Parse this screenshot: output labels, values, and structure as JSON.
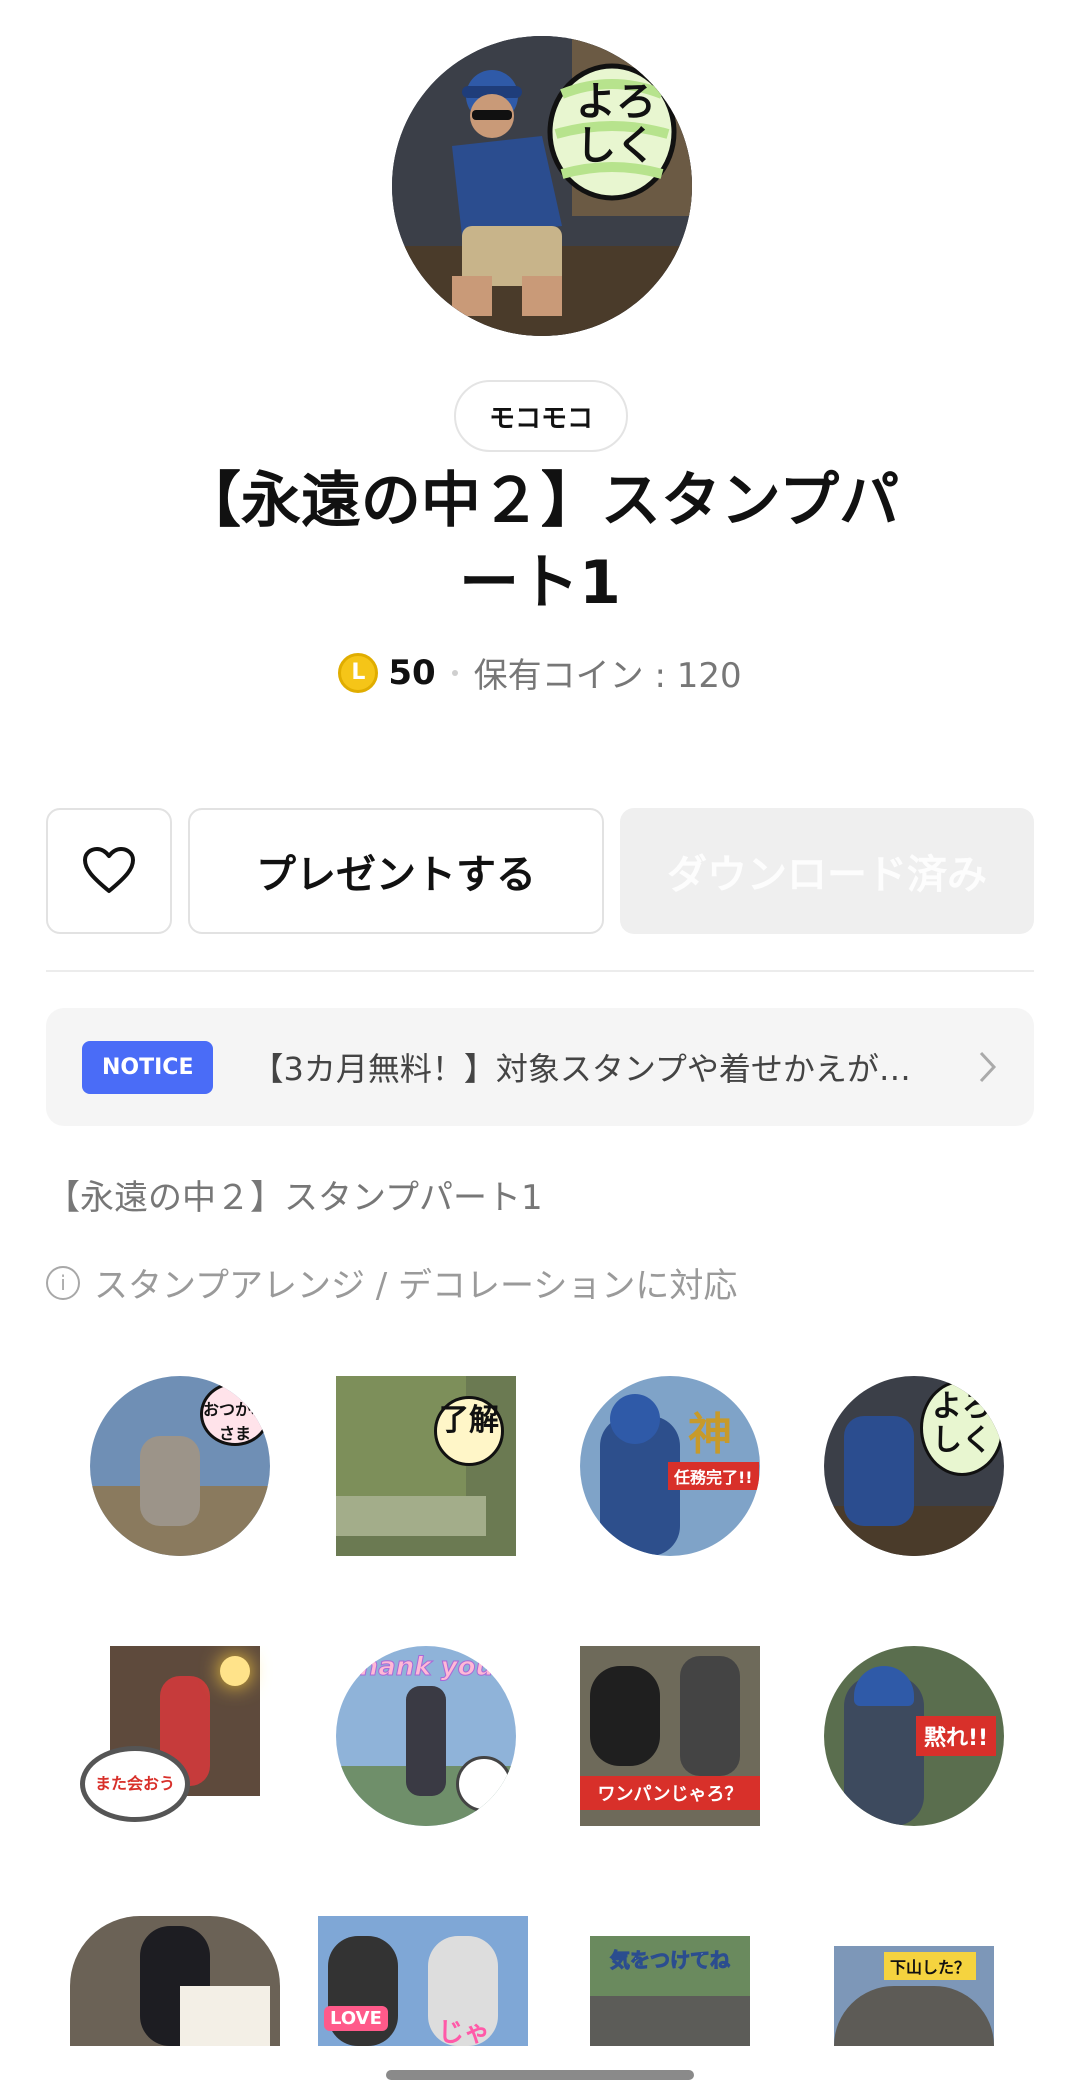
{
  "header": {
    "creator": "モコモコ",
    "title_line1": "【永遠の中２】スタンプパ",
    "title_line2": "ート1"
  },
  "pricing": {
    "coin_symbol": "L",
    "price": "50",
    "owned_coins": "保有コイン : 120"
  },
  "actions": {
    "present_label": "プレゼントする",
    "download_label": "ダウンロード済み"
  },
  "notice": {
    "badge": "NOTICE",
    "text": "【3カ月無料！】対象スタンプや着せかえが…"
  },
  "pack": {
    "name": "【永遠の中２】スタンプパート1",
    "support_text": "スタンプアレンジ / デコレーションに対応",
    "info_symbol": "i"
  },
  "hero_sticker": {
    "caption_line1": "よろ",
    "caption_line2": "しく"
  },
  "stickers": [
    {
      "caption": "おつかれさま"
    },
    {
      "caption": "了解"
    },
    {
      "caption": "神",
      "sub": "任務完了!!"
    },
    {
      "caption": "よろしく"
    },
    {
      "caption": "また会おう"
    },
    {
      "caption": "Thank you"
    },
    {
      "caption": "ワンパンじゃろ？"
    },
    {
      "caption": "黙れ!!"
    },
    {
      "caption": ""
    },
    {
      "caption": "LOVE",
      "sub": "じゃ"
    },
    {
      "caption": "気をつけてね"
    },
    {
      "caption": "下山した？"
    }
  ],
  "colors": {
    "notice_badge": "#4a6cf7",
    "coin": "#f5c518",
    "download_bg": "#efefef"
  }
}
